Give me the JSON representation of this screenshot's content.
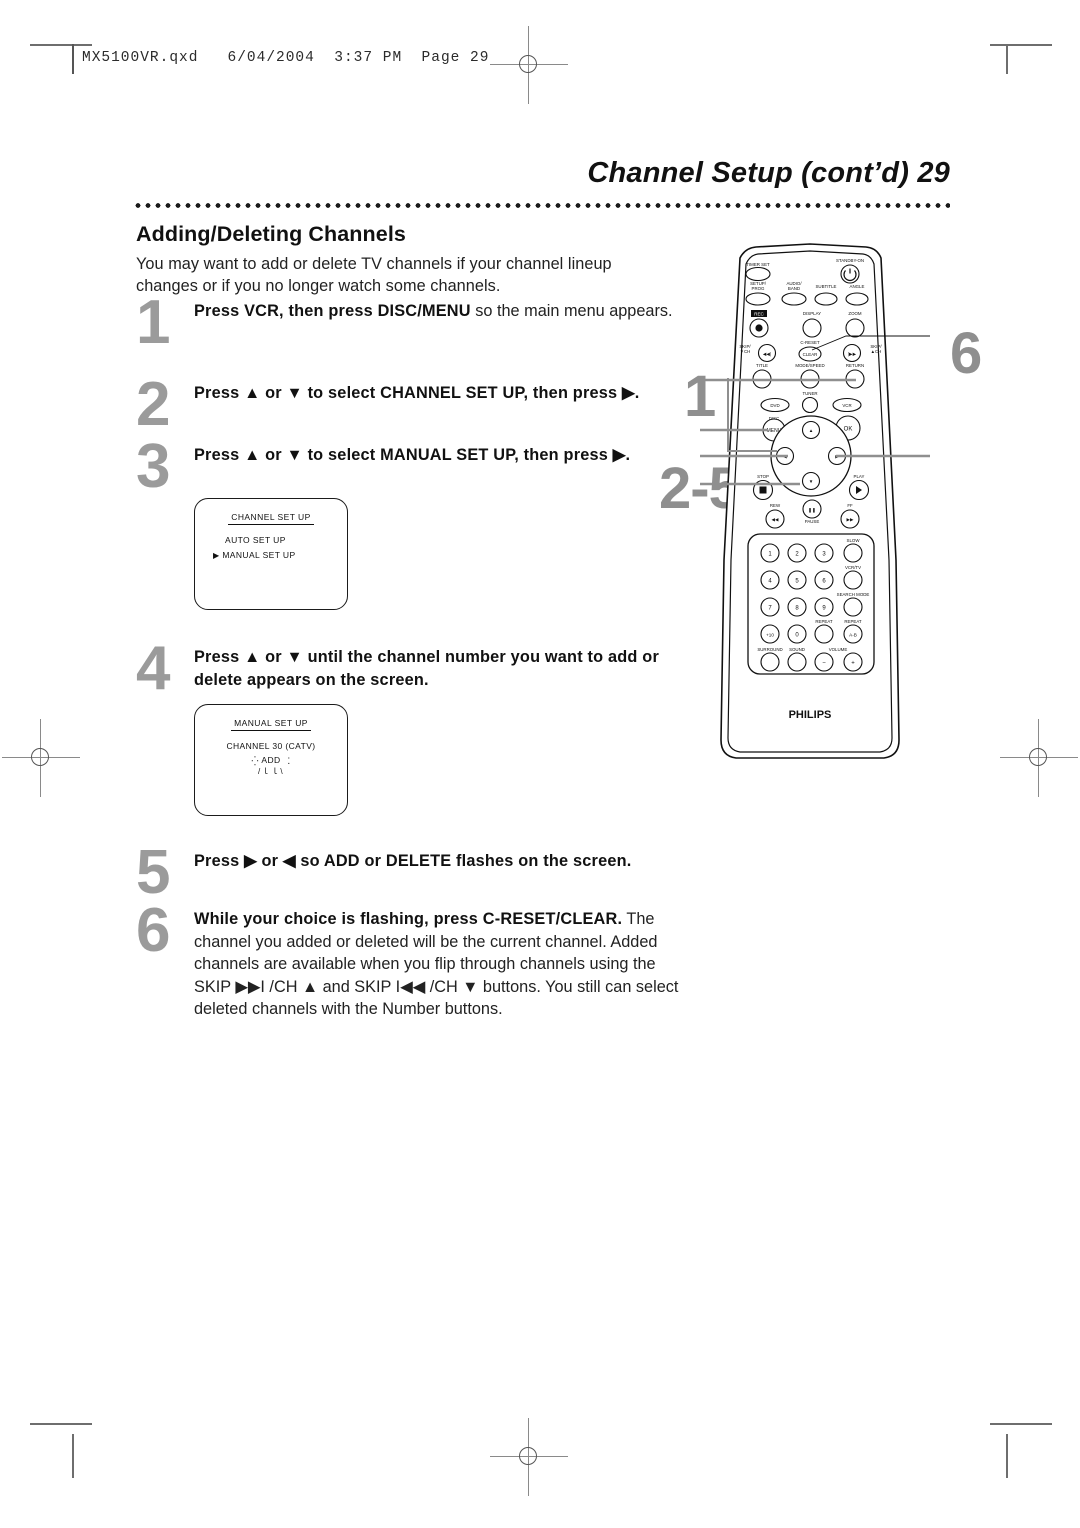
{
  "printmark": {
    "file_stamp": "MX5100VR.qxd   6/04/2004  3:37 PM  Page 29"
  },
  "header": {
    "title": "Channel Setup (cont’d)  29"
  },
  "section": {
    "heading": "Adding/Deleting Channels",
    "intro": "You may want to add or delete TV channels if your channel lineup changes or if you no longer watch some channels."
  },
  "steps": [
    {
      "num": "1",
      "bold": "Press VCR, then press DISC/MENU",
      "rest": " so the main menu appears."
    },
    {
      "num": "2",
      "bold": "Press ▲ or ▼ to select CHANNEL SET UP,  then press ▶.",
      "rest": ""
    },
    {
      "num": "3",
      "bold": "Press ▲ or ▼ to select MANUAL SET UP, then press ▶.",
      "rest": ""
    },
    {
      "num": "4",
      "bold": "Press ▲ or ▼ until the channel number you want to add or delete appears on the screen.",
      "rest": ""
    },
    {
      "num": "5",
      "bold": "Press ▶ or ◀ so ADD or DELETE flashes on the screen.",
      "rest": ""
    },
    {
      "num": "6",
      "bold": "While your choice is flashing, press C-RESET/CLEAR.",
      "rest": " The channel you added or deleted will be the current channel. Added channels are available when you flip through channels using the SKIP ▶▶I /CH ▲ and SKIP I◀◀ /CH ▼ buttons. You still can select deleted channels with the Number buttons."
    }
  ],
  "osd_channel_setup": {
    "title": "CHANNEL SET UP",
    "items": [
      "AUTO SET UP",
      "MANUAL SET UP"
    ],
    "cursor": "▶",
    "selected_index": 1
  },
  "osd_manual_setup": {
    "title": "MANUAL SET UP",
    "channel_label": "CHANNEL",
    "channel_number": "30",
    "band": "(CATV)",
    "flashing_value": "ADD"
  },
  "remote": {
    "brand": "PHILIPS",
    "callouts": [
      {
        "label": "6",
        "target": "c-reset-clear"
      },
      {
        "label": "1",
        "target": "vcr-and-disc-menu"
      },
      {
        "label": "2-5",
        "target": "navigation-pad"
      }
    ],
    "buttons": {
      "timer_set": "TIMER SET",
      "standby_on": "STANDBY-ON",
      "setup_prog_1": "SETUP/",
      "setup_prog_2": "PROG",
      "audio_band_1": "AUDIO/",
      "audio_band_2": "BAND",
      "subtitle": "SUBTITLE",
      "angle": "ANGLE",
      "rec": "REC",
      "display": "DISPLAY",
      "zoom": "ZOOM",
      "c_reset": "C-RESET",
      "clear": "CLEAR",
      "skip_down_1": "SKIP/",
      "skip_down_2": "▼CH",
      "skip_up_1": "SKIP/",
      "skip_up_2": "▲CH",
      "title": "TITLE",
      "mode_speed": "MODE/SPEED",
      "return": "RETURN",
      "dvd": "DVD",
      "tuner": "TUNER",
      "vcr": "VCR",
      "disc": "DISC",
      "menu": "MENU",
      "ok": "OK",
      "stop": "STOP",
      "play": "PLAY",
      "rew": "REW",
      "pause": "PAUSE",
      "ff": "FF",
      "slow": "SLOW",
      "vcr_tv": "VCR/TV",
      "search_mode": "SEARCH MODE",
      "repeat": "REPEAT",
      "repeat_ab_lbl": "REPEAT",
      "repeat_ab": "A-B",
      "surround": "SURROUND",
      "sound": "SOUND",
      "volume": "VOLUME",
      "vol_minus": "−",
      "vol_plus": "+",
      "keys": [
        "1",
        "2",
        "3",
        "4",
        "5",
        "6",
        "7",
        "8",
        "9",
        "+10",
        "0"
      ]
    }
  }
}
